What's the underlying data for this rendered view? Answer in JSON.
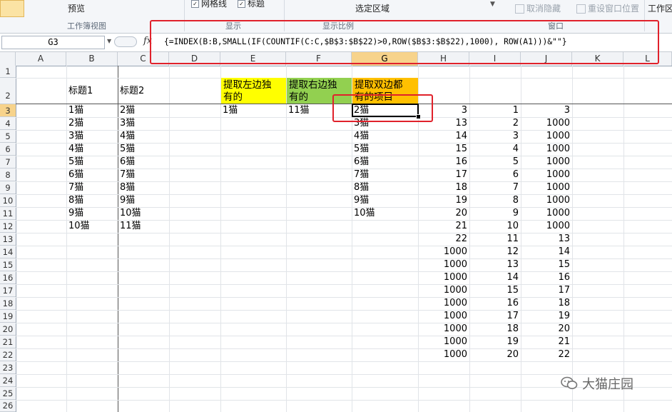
{
  "ribbon": {
    "preview": "预览",
    "gridlines": "网格线",
    "titles": "标题",
    "zoom_selection": "选定区域",
    "unhide": "取消隐藏",
    "reset_window_pos": "重设窗口位置",
    "workspace": "工作区",
    "groups": {
      "workbook_views": "工作簿视图",
      "show": "显示",
      "zoom": "显示比例",
      "window": "窗口"
    }
  },
  "formula_bar": {
    "name_box": "G3",
    "fx": "fx",
    "formula": "{=INDEX(B:B,SMALL(IF(COUNTIF(C:C,$B$3:$B$22)>0,ROW($B$3:$B$22),1000), ROW(A1)))&\"\"}"
  },
  "columns": [
    "A",
    "B",
    "C",
    "D",
    "E",
    "F",
    "G",
    "H",
    "I",
    "J",
    "K",
    "L"
  ],
  "rows": [
    "1",
    "2",
    "3",
    "4",
    "5",
    "6",
    "7",
    "8",
    "9",
    "10",
    "11",
    "12",
    "13",
    "14",
    "15",
    "16",
    "17",
    "18",
    "19",
    "20",
    "21",
    "22",
    "23",
    "24",
    "25",
    "26"
  ],
  "headers": {
    "b2": "标题1",
    "c2": "标题2",
    "e2_line1": "提取左边独",
    "e2_line2": "有的",
    "f2_line1": "提取右边独",
    "f2_line2": "有的",
    "g2_line1": "提取双边都",
    "g2_line2": "有的项目"
  },
  "col_b": [
    "1猫",
    "2猫",
    "3猫",
    "4猫",
    "5猫",
    "6猫",
    "7猫",
    "8猫",
    "9猫",
    "10猫"
  ],
  "col_c": [
    "2猫",
    "3猫",
    "4猫",
    "5猫",
    "6猫",
    "7猫",
    "8猫",
    "9猫",
    "10猫",
    "11猫"
  ],
  "e3": "1猫",
  "f3": "11猫",
  "col_g": [
    "2猫",
    "3猫",
    "4猫",
    "5猫",
    "6猫",
    "7猫",
    "8猫",
    "9猫",
    "10猫"
  ],
  "col_h": [
    "3",
    "13",
    "14",
    "15",
    "16",
    "17",
    "18",
    "19",
    "20",
    "21",
    "22",
    "1000",
    "1000",
    "1000",
    "1000",
    "1000",
    "1000",
    "1000",
    "1000",
    "1000"
  ],
  "col_i": [
    "1",
    "2",
    "3",
    "4",
    "5",
    "6",
    "7",
    "8",
    "9",
    "10",
    "11",
    "12",
    "13",
    "14",
    "15",
    "16",
    "17",
    "18",
    "19",
    "20"
  ],
  "col_j": [
    "3",
    "1000",
    "1000",
    "1000",
    "1000",
    "1000",
    "1000",
    "1000",
    "1000",
    "1000",
    "13",
    "14",
    "15",
    "16",
    "17",
    "18",
    "19",
    "20",
    "21",
    "22"
  ],
  "watermark": "大猫庄园",
  "colors": {
    "yellow": "#ffff00",
    "green": "#92d050",
    "orange": "#ffc000",
    "red": "#e0212b"
  }
}
